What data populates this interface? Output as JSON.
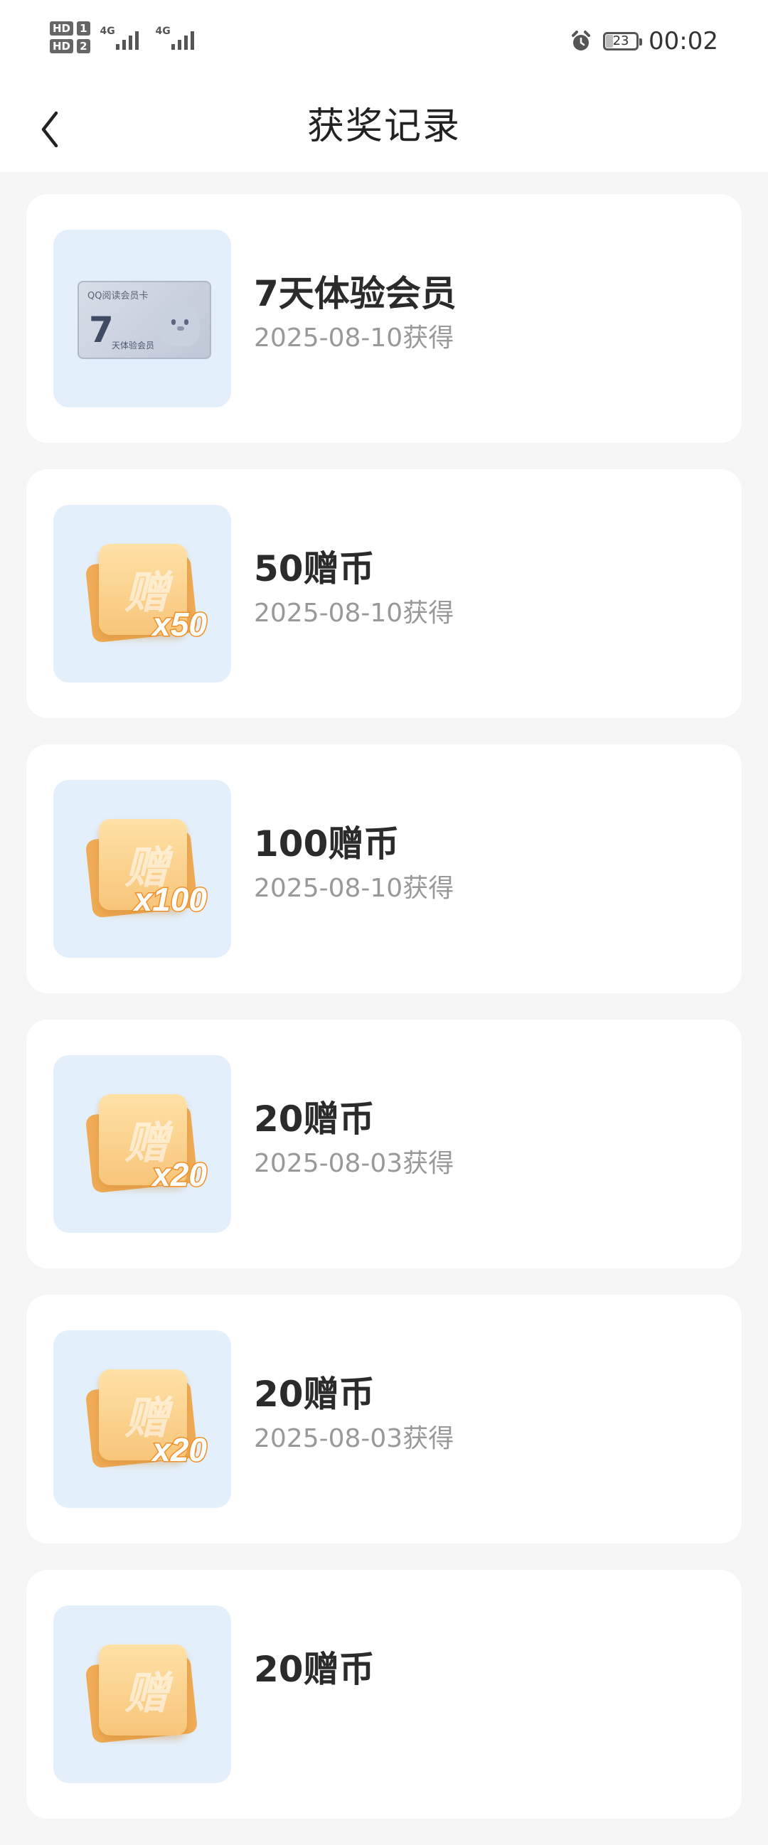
{
  "status_bar": {
    "sim1_badge": "HD",
    "sim1_slot": "1",
    "sim2_badge": "HD",
    "sim2_slot": "2",
    "network1": "4G",
    "network2": "4G",
    "battery_level": "23",
    "time": "00:02",
    "icons": [
      "alarm-icon",
      "battery-icon",
      "signal-icon"
    ]
  },
  "header": {
    "title": "获奖记录",
    "back_icon": "chevron-left-icon"
  },
  "records": [
    {
      "name": "7天体验会员",
      "date": "2025-08-10获得",
      "type": "member-card",
      "card_brand": "QQ阅读会员卡",
      "card_number": "7",
      "card_label": "天体验会员"
    },
    {
      "name": "50赠币",
      "date": "2025-08-10获得",
      "type": "coin",
      "coin_char": "赠",
      "coin_qty": "x50"
    },
    {
      "name": "100赠币",
      "date": "2025-08-10获得",
      "type": "coin",
      "coin_char": "赠",
      "coin_qty": "x100"
    },
    {
      "name": "20赠币",
      "date": "2025-08-03获得",
      "type": "coin",
      "coin_char": "赠",
      "coin_qty": "x20"
    },
    {
      "name": "20赠币",
      "date": "2025-08-03获得",
      "type": "coin",
      "coin_char": "赠",
      "coin_qty": "x20"
    },
    {
      "name": "20赠币",
      "date": "",
      "type": "coin",
      "coin_char": "赠",
      "coin_qty": ""
    }
  ],
  "colors": {
    "background": "#f5f5f5",
    "card": "#ffffff",
    "thumb_bg": "#e3f0fc",
    "title_text": "#2b2b2b",
    "date_text": "#999999",
    "coin_orange": "#f08f28"
  }
}
